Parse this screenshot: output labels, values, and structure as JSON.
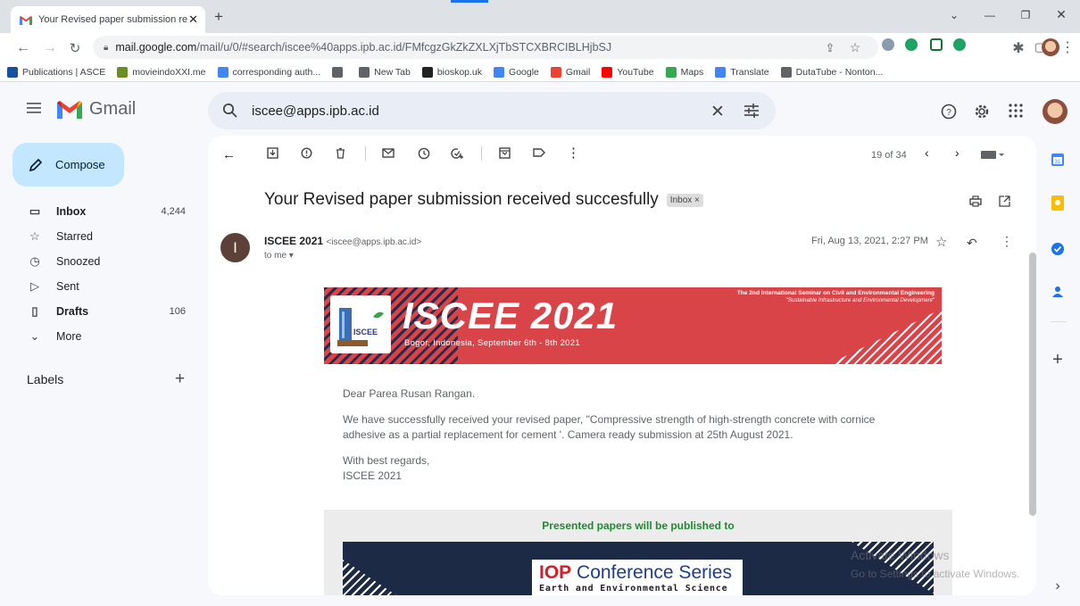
{
  "browser": {
    "tab_title": "Your Revised paper submission re",
    "tab_close": "✕",
    "new_tab": "+",
    "url_domain": "mail.google.com",
    "url_path": "/mail/u/0/#search/iscee%40apps.ipb.ac.id/FMfcgzGkZkZXLXjTbSTCXBRCIBLHjbSJ",
    "bookmarks": [
      {
        "label": "Publications | ASCE",
        "icon": "asce-icon",
        "color": "#1a4f9c"
      },
      {
        "label": "movieindoXXI.me",
        "icon": "movie-icon",
        "color": "#6b8e23"
      },
      {
        "label": "corresponding auth...",
        "icon": "google-icon",
        "color": "#4285f4"
      },
      {
        "label": "",
        "icon": "globe-icon",
        "color": "#5f6368"
      },
      {
        "label": "New Tab",
        "icon": "globe-icon",
        "color": "#5f6368"
      },
      {
        "label": "bioskop.uk",
        "icon": "bioskop-icon",
        "color": "#222222"
      },
      {
        "label": "Google",
        "icon": "google-icon",
        "color": "#4285f4"
      },
      {
        "label": "Gmail",
        "icon": "gmail-icon",
        "color": "#ea4335"
      },
      {
        "label": "YouTube",
        "icon": "youtube-icon",
        "color": "#ff0000"
      },
      {
        "label": "Maps",
        "icon": "maps-icon",
        "color": "#34a853"
      },
      {
        "label": "Translate",
        "icon": "translate-icon",
        "color": "#4285f4"
      },
      {
        "label": "DutaTube - Nonton...",
        "icon": "globe-icon",
        "color": "#5f6368"
      }
    ]
  },
  "gmail": {
    "brand": "Gmail",
    "search_query": "iscee@apps.ipb.ac.id",
    "compose": "Compose",
    "nav": [
      {
        "label": "Inbox",
        "count": "4,244",
        "bold": true,
        "icon": "inbox-icon"
      },
      {
        "label": "Starred",
        "count": "",
        "bold": false,
        "icon": "star-icon"
      },
      {
        "label": "Snoozed",
        "count": "",
        "bold": false,
        "icon": "clock-icon"
      },
      {
        "label": "Sent",
        "count": "",
        "bold": false,
        "icon": "send-icon"
      },
      {
        "label": "Drafts",
        "count": "106",
        "bold": true,
        "icon": "draft-icon"
      },
      {
        "label": "More",
        "count": "",
        "bold": false,
        "icon": "chevron-down-icon"
      }
    ],
    "labels_title": "Labels",
    "labels_add": "+",
    "pager": "19 of 34"
  },
  "email": {
    "subject": "Your Revised paper submission received succesfully",
    "label_chip": "Inbox ×",
    "sender_initial": "I",
    "sender_name": "ISCEE 2021",
    "sender_email": "<iscee@apps.ipb.ac.id>",
    "to": "to me ▾",
    "date": "Fri, Aug 13, 2021, 2:27 PM",
    "banner": {
      "title": "ISCEE 2021",
      "place_date": "Bogor, Indonesia, September 6th - 8th 2021",
      "seminar": "The 2nd International Seminar on Civil and Environmental Engineering",
      "theme": "\"Sustainable Infrastructure and Environmental Development\"",
      "logo_text": "ISCEE"
    },
    "greeting": "Dear Parea Rusan Rangan.",
    "para1": "We have successfully received your revised paper, \"Compressive strength of high-strength concrete with cornice",
    "para2": "adhesive as a partial replacement for cement '. Camera ready submission at 25th August 2021.",
    "closing1": "With best regards,",
    "closing2": "ISCEE 2021",
    "published_to": "Presented papers will be published to",
    "iop_iop": "IOP",
    "iop_series": "Conference Series",
    "iop_sub": "Earth and Environmental Science"
  },
  "watermark": {
    "line1": "Activate Windows",
    "line2": "Go to Settings to activate Windows."
  }
}
